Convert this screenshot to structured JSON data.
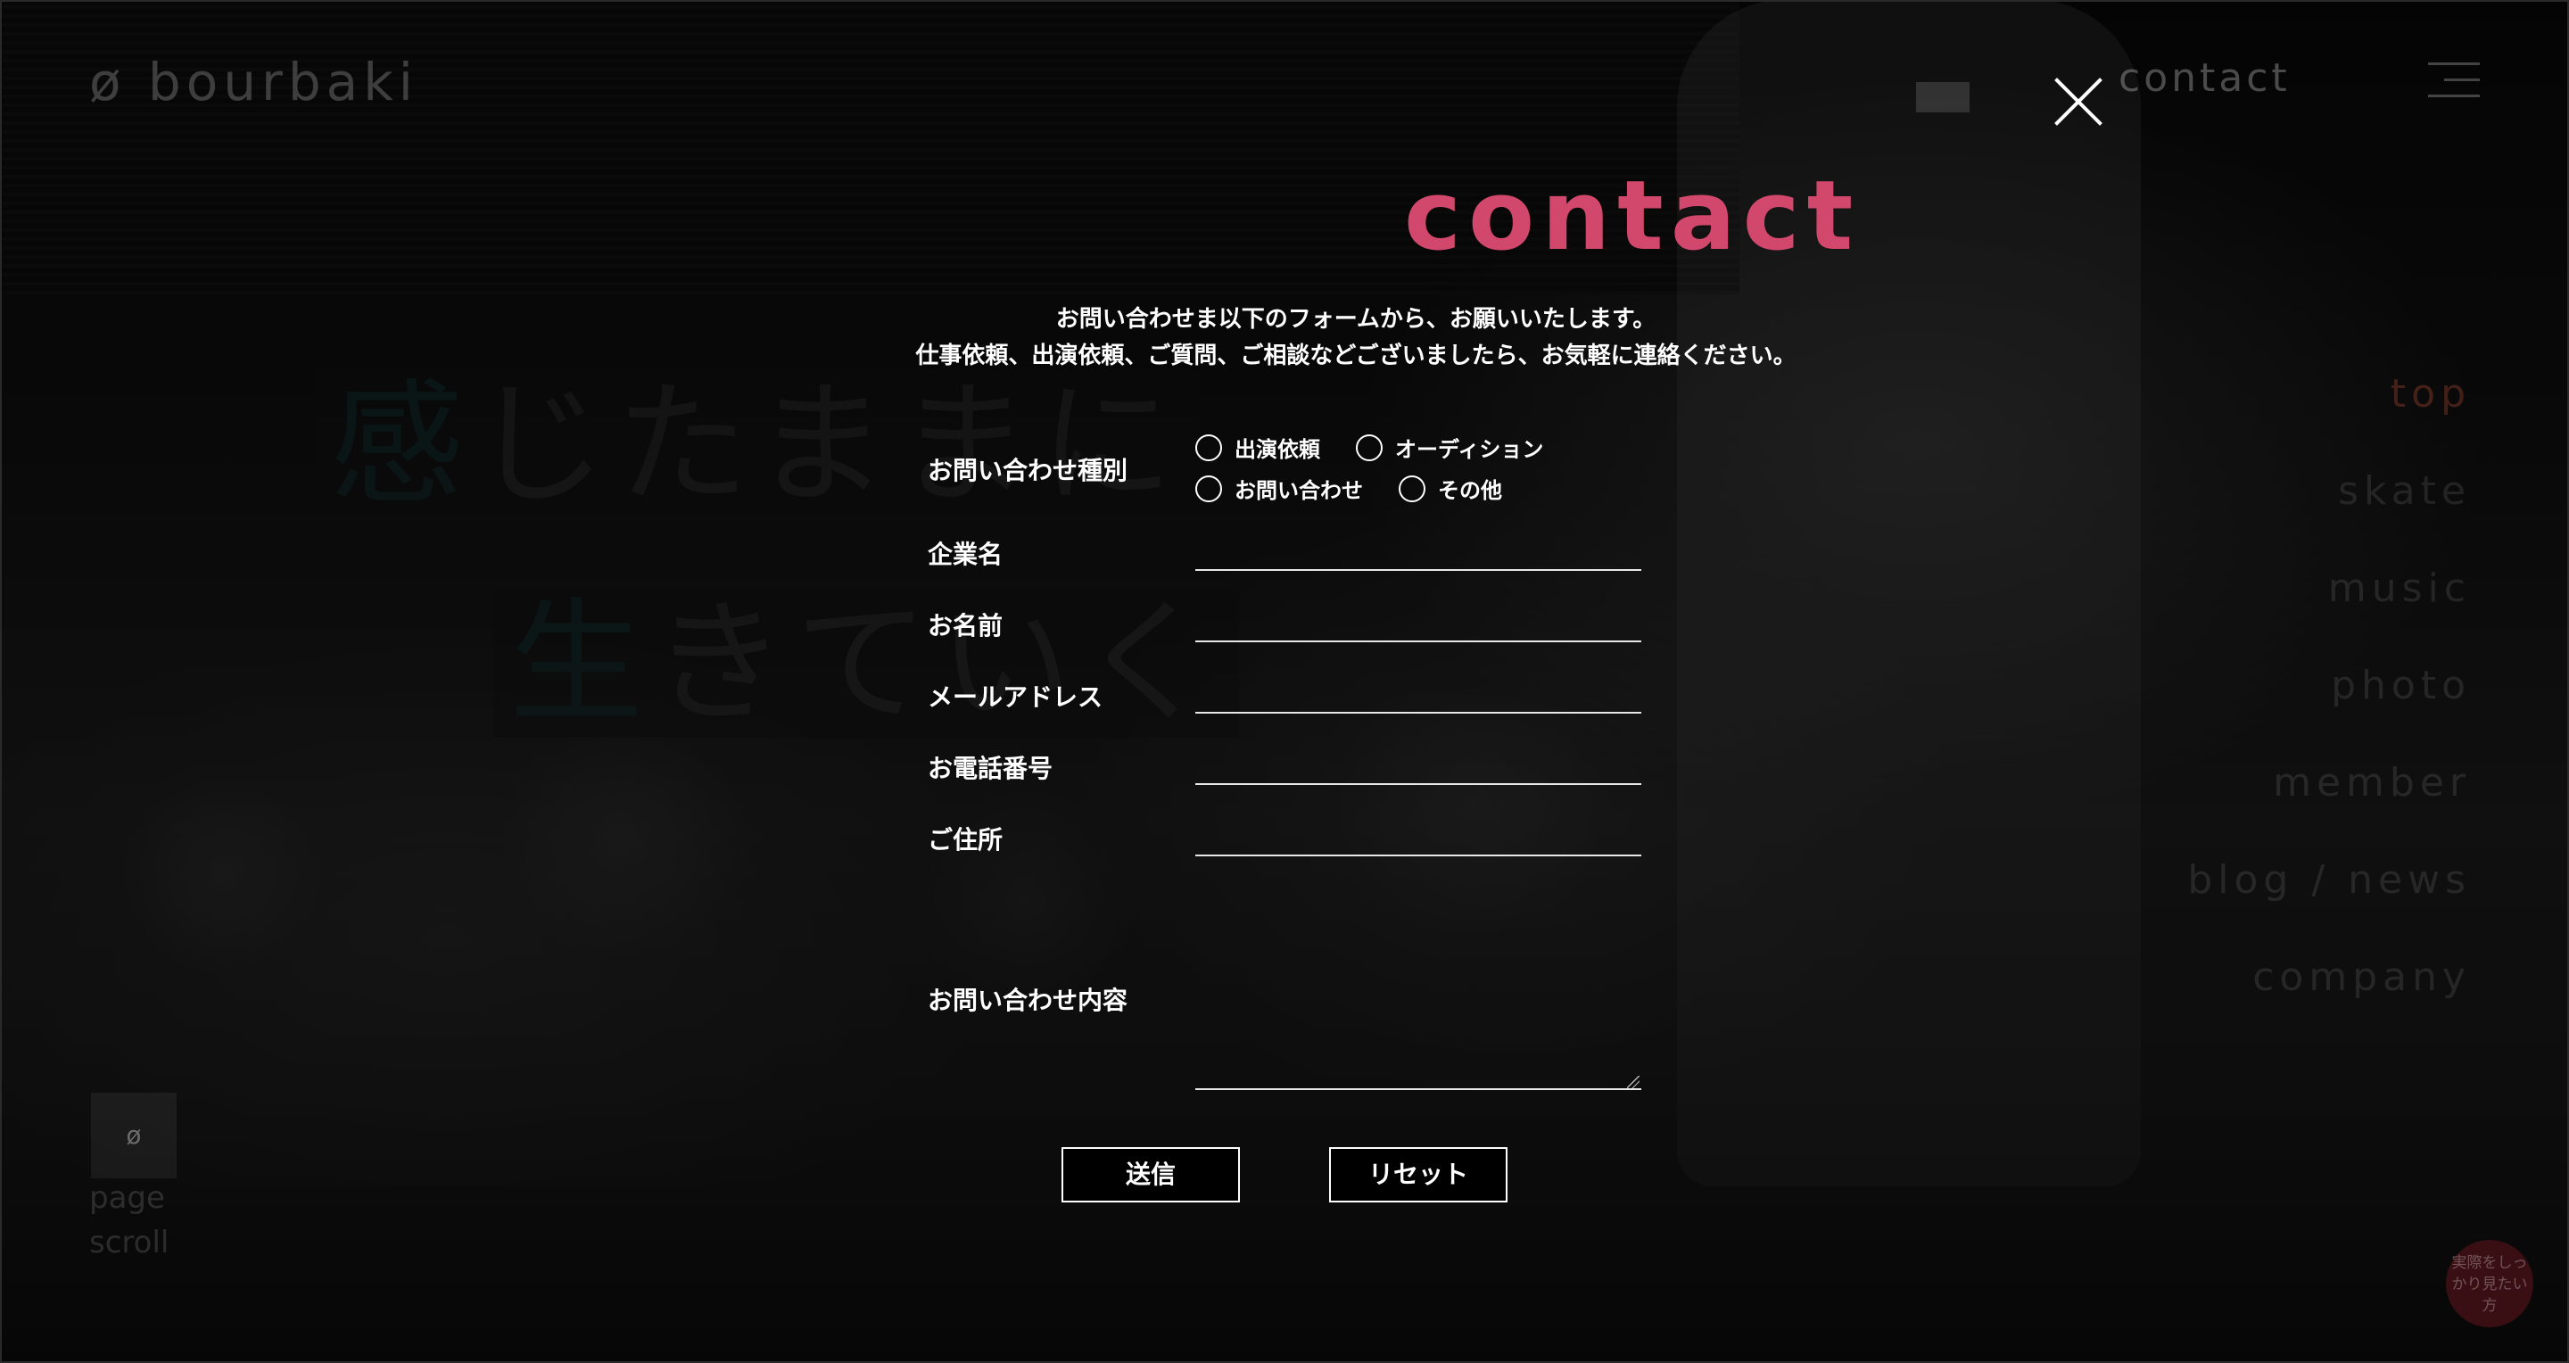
{
  "header": {
    "logo": "ø bourbaki",
    "contact_label": "contact"
  },
  "nav": {
    "items": [
      "top",
      "skate",
      "music",
      "photo",
      "member",
      "blog / news",
      "company"
    ],
    "active": "top"
  },
  "hero": {
    "line1": "感じたままに",
    "line2": "生きていく"
  },
  "scroll": {
    "icon": "ø",
    "label_line1": "page",
    "label_line2": "scroll"
  },
  "badge": {
    "text": "実際をしっかり見たい方"
  },
  "modal": {
    "title": "contact",
    "intro_line1": "お問い合わせま以下のフォームから、お願いいたします。",
    "intro_line2": "仕事依頼、出演依頼、ご質問、ご相談などございましたら、お気軽に連絡ください。",
    "inquiry_type": {
      "label": "お問い合わせ種別",
      "options": [
        "出演依頼",
        "オーディション",
        "お問い合わせ",
        "その他"
      ]
    },
    "fields": {
      "company_label": "企業名",
      "name_label": "お名前",
      "email_label": "メールアドレス",
      "phone_label": "お電話番号",
      "address_label": "ご住所",
      "message_label": "お問い合わせ内容"
    },
    "submit_label": "送信",
    "reset_label": "リセット"
  },
  "colors": {
    "accent": "#d2486c",
    "background": "#050505",
    "text": "#ffffff"
  },
  "icons": {
    "close": "close-icon",
    "menu": "hamburger-menu-icon"
  }
}
